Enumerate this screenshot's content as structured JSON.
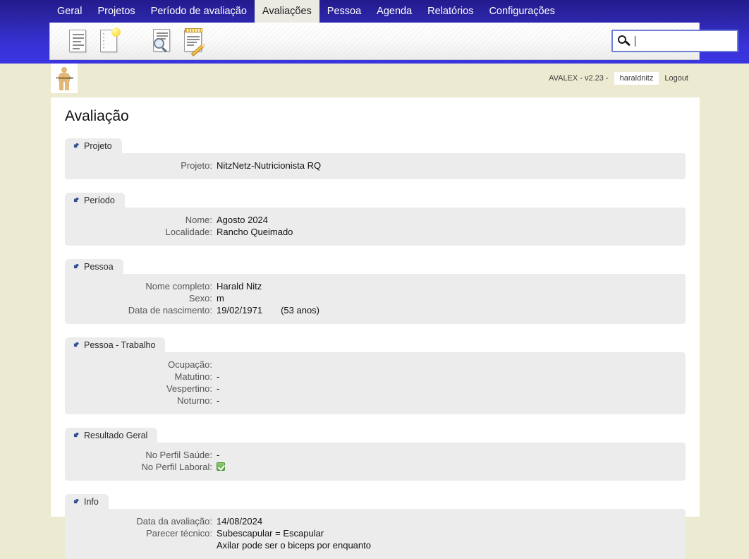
{
  "menu": {
    "items": [
      {
        "label": "Geral",
        "active": false
      },
      {
        "label": "Projetos",
        "active": false
      },
      {
        "label": "Período de avaliação",
        "active": false
      },
      {
        "label": "Avaliações",
        "active": true
      },
      {
        "label": "Pessoa",
        "active": false
      },
      {
        "label": "Agenda",
        "active": false
      },
      {
        "label": "Relatórios",
        "active": false
      },
      {
        "label": "Configurações",
        "active": false
      }
    ]
  },
  "toolbar": {
    "icons": [
      {
        "name": "document-icon",
        "title": "Documento"
      },
      {
        "name": "new-document-icon",
        "title": "Novo"
      },
      {
        "name": "search-document-icon",
        "title": "Consultar"
      },
      {
        "name": "edit-notepad-icon",
        "title": "Editar"
      }
    ],
    "search": {
      "value": "",
      "placeholder": ""
    }
  },
  "header": {
    "logo_text": "FuncionalDI",
    "app_version": "AVALEX - v2.23 -",
    "user": "haraldnitz",
    "logout": "Logout"
  },
  "page": {
    "title": "Avaliação"
  },
  "sections": [
    {
      "tab": "Projeto",
      "rows": [
        {
          "label": "Projeto:",
          "value": "NitzNetz-Nutricionista RQ"
        }
      ]
    },
    {
      "tab": "Período",
      "rows": [
        {
          "label": "Nome:",
          "value": "Agosto 2024"
        },
        {
          "label": "Localidade:",
          "value": "Rancho Queimado"
        }
      ]
    },
    {
      "tab": "Pessoa",
      "rows": [
        {
          "label": "Nome completo:",
          "value": "Harald Nitz"
        },
        {
          "label": "Sexo:",
          "value": "m"
        },
        {
          "label": "Data de nascimento:",
          "value": "19/02/1971",
          "extra": "(53 anos)"
        }
      ]
    },
    {
      "tab": "Pessoa - Trabalho",
      "rows": [
        {
          "label": "Ocupação:",
          "value": ""
        },
        {
          "label": "Matutino:",
          "value": "-"
        },
        {
          "label": "Vespertino:",
          "value": "-"
        },
        {
          "label": "Noturno:",
          "value": "-"
        }
      ]
    },
    {
      "tab": "Resultado Geral",
      "rows": [
        {
          "label": "No Perfil Saúde:",
          "value": "-"
        },
        {
          "label": "No Perfil Laboral:",
          "value": "",
          "check": true
        }
      ]
    },
    {
      "tab": "Info",
      "rows": [
        {
          "label": "Data da avaliação:",
          "value": "14/08/2024"
        },
        {
          "label": "Parecer técnico:",
          "value": "Subescapular = Escapular"
        },
        {
          "label": "",
          "value": "Axilar pode ser o biceps por enquanto"
        }
      ]
    }
  ],
  "colors": {
    "chrome_blue_dark": "#221a8c",
    "chrome_blue_light": "#3b35e0",
    "page_bg": "#ecead0",
    "panel_gray": "#ececec",
    "accent_green": "#5aa83f"
  }
}
